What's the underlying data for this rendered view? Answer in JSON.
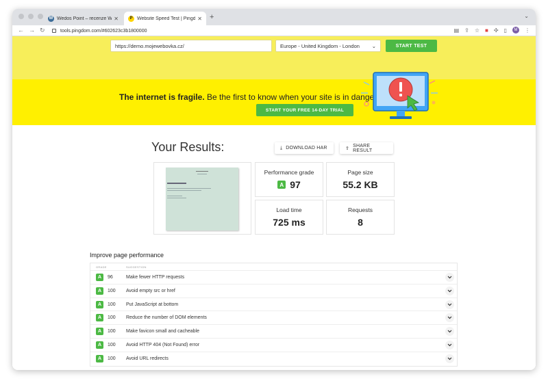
{
  "browser": {
    "tabs": [
      {
        "title": "Wedos Point – recenze Wedos",
        "active": false
      },
      {
        "title": "Website Speed Test | Pingdom",
        "active": true
      }
    ],
    "url": "tools.pingdom.com/#602623c3b1800000",
    "avatar_letter": "M"
  },
  "test_form": {
    "url_value": "https://demo.mojewebovka.cz/",
    "location_value": "Europe - United Kingdom - London",
    "start_label": "START TEST"
  },
  "banner": {
    "bold": "The internet is fragile.",
    "rest": " Be the first to know when your site is in danger.",
    "cta": "START YOUR FREE 14-DAY TRIAL"
  },
  "results": {
    "title": "Your Results:",
    "download_har": "DOWNLOAD HAR",
    "share_result": "SHARE RESULT",
    "cards": {
      "grade_label": "Performance grade",
      "grade_letter": "A",
      "grade_value": "97",
      "size_label": "Page size",
      "size_value": "55.2 KB",
      "load_label": "Load time",
      "load_value": "725 ms",
      "req_label": "Requests",
      "req_value": "8"
    }
  },
  "improve": {
    "title": "Improve page performance",
    "col_grade": "GRADE",
    "col_suggestion": "SUGGESTION",
    "rows": [
      {
        "grade": "A",
        "score": "96",
        "text": "Make fewer HTTP requests"
      },
      {
        "grade": "A",
        "score": "100",
        "text": "Avoid empty src or href"
      },
      {
        "grade": "A",
        "score": "100",
        "text": "Put JavaScript at bottom"
      },
      {
        "grade": "A",
        "score": "100",
        "text": "Reduce the number of DOM elements"
      },
      {
        "grade": "A",
        "score": "100",
        "text": "Make favicon small and cacheable"
      },
      {
        "grade": "A",
        "score": "100",
        "text": "Avoid HTTP 404 (Not Found) error"
      },
      {
        "grade": "A",
        "score": "100",
        "text": "Avoid URL redirects"
      }
    ]
  },
  "colors": {
    "accent_green": "#4cb944",
    "banner_yellow": "#fff000",
    "hero_yellow": "#f7ee5a"
  }
}
